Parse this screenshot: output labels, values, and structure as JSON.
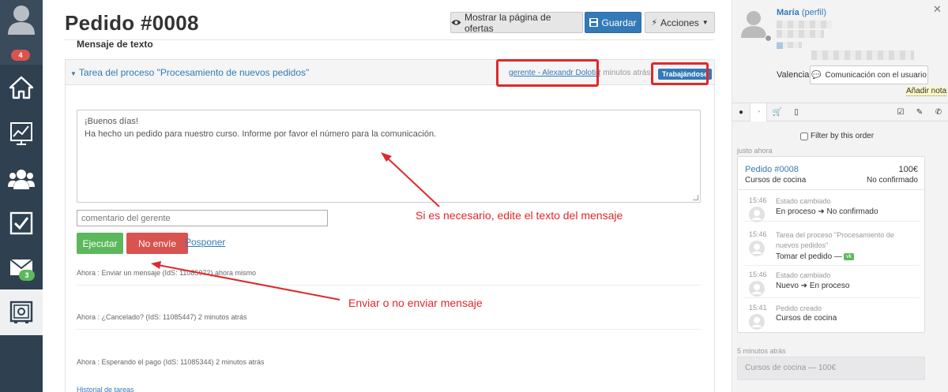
{
  "nav": {
    "badge_notifications": "4",
    "badge_messages": "3"
  },
  "header": {
    "title": "Pedido #0008",
    "show_offers_label": "Mostrar la página de ofertas",
    "save_label": "Guardar",
    "actions_label": "Acciones"
  },
  "task": {
    "title": "Tarea del proceso \"Procesamiento de nuevos pedidos\"",
    "assignee": "gerente - Alexandr Dolotin",
    "time_ago": "2 minutos atrás",
    "status": "Trabajándose",
    "message_label": "Mensaje de texto",
    "message_line1": "¡Buenos días!",
    "message_line2": "Ha hecho un pedido para nuestro curso. Informe por favor el número para la comunicación.",
    "comment_placeholder": "comentario del gerente",
    "execute_label": "Ejecutar",
    "dont_send_label": "No envíe",
    "postpone_label": "Posponer",
    "history": [
      "Ahora : Enviar un mensaje (IdS: 11085972) ahora mismo",
      "Ahora : ¿Cancelado? (IdS: 11085447) 2 minutos atrás",
      "Ahora : Esperando el pago (IdS: 11085344) 2 minutos atrás"
    ],
    "history_link": "Historial de tareas"
  },
  "annotations": {
    "edit_text": "Si es necesario, edite el texto del mensaje",
    "send_or_not": "Enviar o no enviar mensaje"
  },
  "sidebar": {
    "user_name": "María",
    "profile_link": "(perfil)",
    "city": "Valencia",
    "communicate_label": "Comunicación con el usuario",
    "add_note_label": "Añadir nota",
    "filter_label": "Filter by this order",
    "just_now": "justo ahora",
    "order": {
      "number": "Pedido #0008",
      "price": "100€",
      "category": "Cursos de cocina",
      "status": "No confirmado"
    },
    "events": [
      {
        "time": "15:46",
        "title": "Estado cambiado",
        "body": "En proceso ➜ No confirmado"
      },
      {
        "time": "15:46",
        "title": "Tarea del proceso \"Procesamiento de nuevos pedidos\"",
        "body": "Tomar el pedido —"
      },
      {
        "time": "15:46",
        "title": "Estado cambiado",
        "body": "Nuevo ➜ En proceso"
      },
      {
        "time": "15:41",
        "title": "Pedido creado",
        "body": "Cursos de cocina"
      }
    ],
    "mins_ago": "5 minutos atrás",
    "old_order": "Cursos de cocina — 100€"
  },
  "colors": {
    "nav_bg": "#2f4050",
    "primary": "#337ab7",
    "success": "#5cb85c",
    "danger": "#d9534f",
    "annotation": "#e0282a"
  }
}
